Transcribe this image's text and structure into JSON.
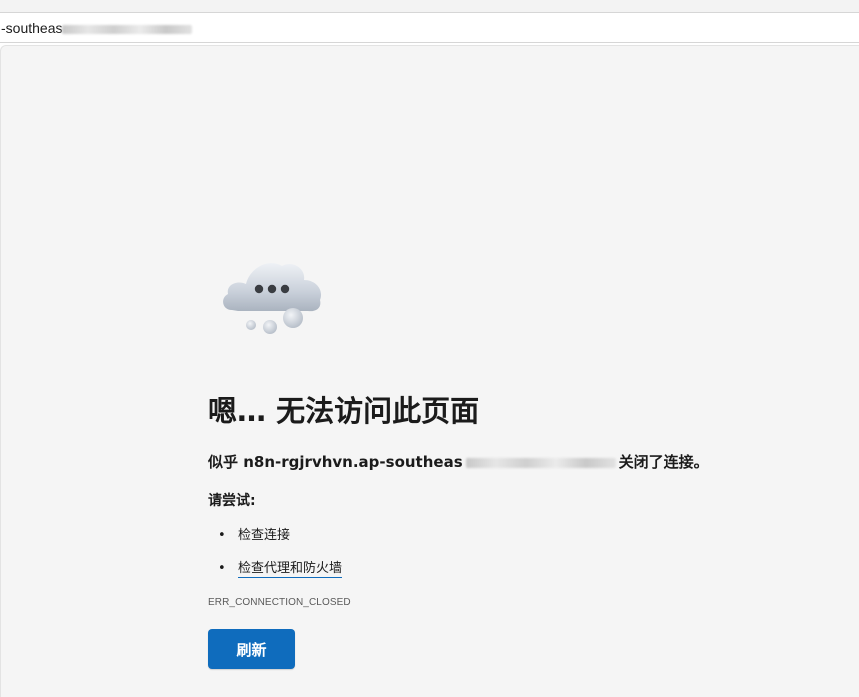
{
  "address_bar": {
    "url_visible": "-southeas"
  },
  "error_page": {
    "title": "嗯… 无法访问此页面",
    "message_prefix": "似乎",
    "host_visible": "n8n-rgjrvhvn.ap-southeas",
    "message_suffix": "关闭了连接。",
    "try_label": "请尝试:",
    "suggestions": [
      {
        "label": "检查连接"
      },
      {
        "label": "检查代理和防火墙"
      }
    ],
    "error_code": "ERR_CONNECTION_CLOSED",
    "refresh_label": "刷新"
  },
  "colors": {
    "background": "#f5f5f5",
    "accent": "#0f6cbd",
    "text": "#1b1b1b"
  },
  "icons": {
    "cloud": "thinking-cloud-icon"
  }
}
